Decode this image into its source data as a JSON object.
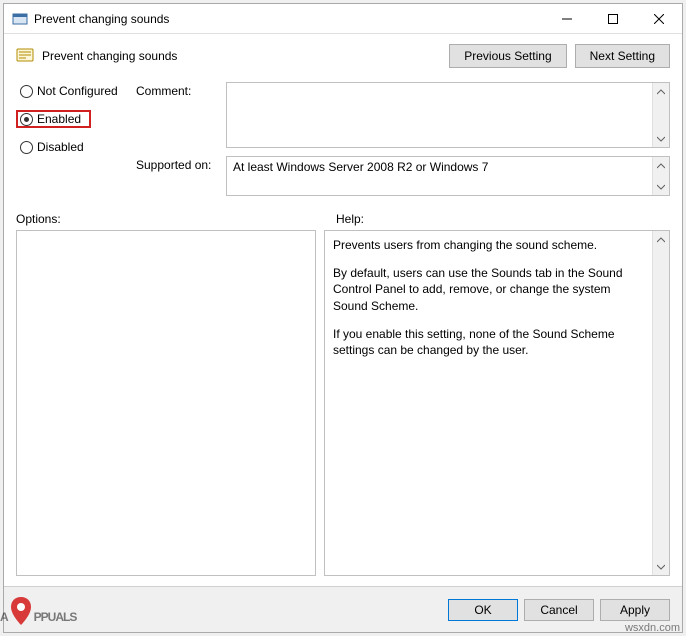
{
  "window": {
    "title": "Prevent changing sounds"
  },
  "header": {
    "title": "Prevent changing sounds",
    "prev_label": "Previous Setting",
    "next_label": "Next Setting"
  },
  "radios": {
    "not_configured": "Not Configured",
    "enabled": "Enabled",
    "disabled": "Disabled"
  },
  "labels": {
    "comment": "Comment:",
    "supported": "Supported on:",
    "options": "Options:",
    "help": "Help:"
  },
  "fields": {
    "comment_value": "",
    "supported_value": "At least Windows Server 2008 R2 or Windows 7"
  },
  "help": {
    "p1": "Prevents users from changing the sound scheme.",
    "p2": "By default, users can use the Sounds tab in the Sound Control Panel to add, remove, or change the system Sound Scheme.",
    "p3": "If you enable this setting, none of the Sound Scheme settings can be changed by the user."
  },
  "footer": {
    "ok": "OK",
    "cancel": "Cancel",
    "apply": "Apply"
  },
  "watermark": {
    "brand": "PPUALS",
    "site": "wsxdn.com"
  }
}
